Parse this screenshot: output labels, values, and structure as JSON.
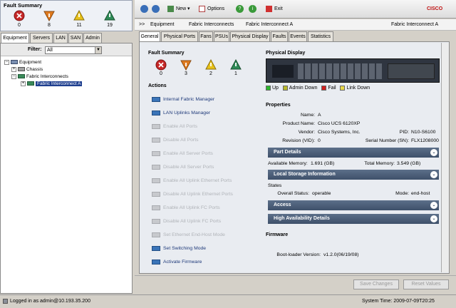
{
  "fault_summary": {
    "title": "Fault Summary",
    "counts": {
      "critical": "0",
      "major": "8",
      "minor": "11",
      "warning": "19"
    }
  },
  "left_tabs": [
    "Equipment",
    "Servers",
    "LAN",
    "SAN",
    "Admin"
  ],
  "filter": {
    "label": "Filter:",
    "value": "All"
  },
  "tree": [
    "Equipment",
    "Chassis",
    "Fabric Interconnects",
    "Fabric Interconnect A"
  ],
  "toolbar": {
    "new_label": "New",
    "options_label": "Options",
    "exit_label": "Exit"
  },
  "breadcrumb": {
    "prefix": ">>",
    "items": [
      "Equipment",
      "Fabric Interconnects",
      "Fabric Interconnect A"
    ],
    "right_label": "Fabric Interconnect A"
  },
  "main_tabs": [
    "General",
    "Physical Ports",
    "Fans",
    "PSUs",
    "Physical Display",
    "Faults",
    "Events",
    "Statistics"
  ],
  "general": {
    "fault_summary_title": "Fault Summary",
    "counts": {
      "critical": "0",
      "major": "3",
      "minor": "2",
      "warning": "1"
    },
    "actions_title": "Actions",
    "actions": [
      {
        "label": "Internal Fabric Manager",
        "enabled": true
      },
      {
        "label": "LAN Uplinks Manager",
        "enabled": true
      },
      {
        "label": "Enable All Ports",
        "enabled": false
      },
      {
        "label": "Disable All Ports",
        "enabled": false
      },
      {
        "label": "Enable All Server Ports",
        "enabled": false
      },
      {
        "label": "Disable All Server Ports",
        "enabled": false
      },
      {
        "label": "Enable All Uplink Ethernet Ports",
        "enabled": false
      },
      {
        "label": "Disable All Uplink Ethernet Ports",
        "enabled": false
      },
      {
        "label": "Enable All Uplink FC Ports",
        "enabled": false
      },
      {
        "label": "Disable All Uplink FC Ports",
        "enabled": false
      },
      {
        "label": "Set Ethernet End-Host Mode",
        "enabled": false
      },
      {
        "label": "Set Switching Mode",
        "enabled": true
      },
      {
        "label": "Activate Firmware",
        "enabled": true
      }
    ]
  },
  "physical_display": {
    "title": "Physical Display",
    "legend": [
      {
        "label": "Up",
        "color": "#2db92d"
      },
      {
        "label": "Admin Down",
        "color": "#b9b92d"
      },
      {
        "label": "Fail",
        "color": "#d02020"
      },
      {
        "label": "Link Down",
        "color": "#e8d84a"
      }
    ]
  },
  "properties": {
    "title": "Properties",
    "name_label": "Name:",
    "name_value": "A",
    "product_label": "Product Name:",
    "product_value": "Cisco UCS 6120XP",
    "vendor_label": "Vendor:",
    "vendor_value": "Cisco Systems, Inc.",
    "pid_label": "PID:",
    "pid_value": "N10-S6100",
    "revision_label": "Revision (VID):",
    "revision_value": "0",
    "serial_label": "Serial Number (SN):",
    "serial_value": "FLX1208000",
    "part_details": "Part Details",
    "avail_mem_label": "Available Memory:",
    "avail_mem_value": "1.691 (GB)",
    "total_mem_label": "Total Memory:",
    "total_mem_value": "3.549 (GB)",
    "local_storage": "Local Storage Information",
    "states_label": "States",
    "overall_label": "Overall Status:",
    "overall_value": "operable",
    "mode_label": "Mode:",
    "mode_value": "end-host",
    "access": "Access",
    "ha_details": "High Availability Details",
    "firmware_title": "Firmware",
    "bootloader_label": "Boot-loader Version:",
    "bootloader_value": "v1.2.0(06/19/08)"
  },
  "buttons": {
    "save": "Save Changes",
    "reset": "Reset Values"
  },
  "status": {
    "logged_in": "Logged in as admin@10.193.35.200",
    "system_time": "System Time: 2009-07-09T20:25"
  },
  "brand": "CISCO",
  "colors": {
    "critical": "#c62828",
    "major": "#e07b1f",
    "minor": "#e8c21a",
    "warning": "#2e8b57",
    "accent": "#3e506a"
  }
}
